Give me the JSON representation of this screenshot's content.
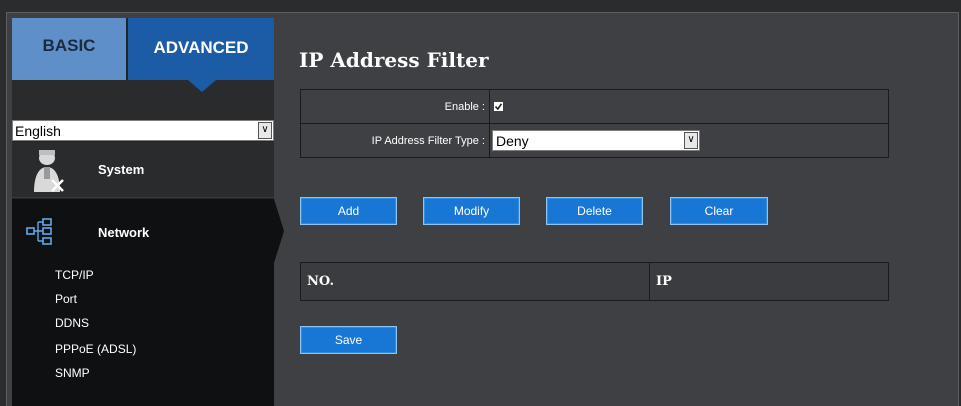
{
  "tabs": {
    "basic": "BASIC",
    "advanced": "ADVANCED"
  },
  "language": {
    "selected": "English",
    "arrow": "∨"
  },
  "nav": {
    "system": "System",
    "network": "Network",
    "network_items": [
      "TCP/IP",
      "Port",
      "DDNS",
      "PPPoE (ADSL)",
      "SNMP"
    ]
  },
  "page": {
    "title": "IP Address Filter",
    "enable_label": "Enable :",
    "enable_checked": true,
    "filter_type_label": "IP Address Filter Type :",
    "filter_type_value": "Deny",
    "select_arrow": "∨"
  },
  "buttons": {
    "add": "Add",
    "modify": "Modify",
    "delete": "Delete",
    "clear": "Clear",
    "save": "Save"
  },
  "table": {
    "col_no": "NO.",
    "col_ip": "IP"
  },
  "colors": {
    "accent": "#1877d4",
    "tab_active": "#1c5ca6",
    "tab_inactive": "#5e8fc9"
  },
  "icons": {
    "system": "user-settings-icon",
    "network": "network-tree-icon",
    "checkbox": "checkmark-icon"
  }
}
